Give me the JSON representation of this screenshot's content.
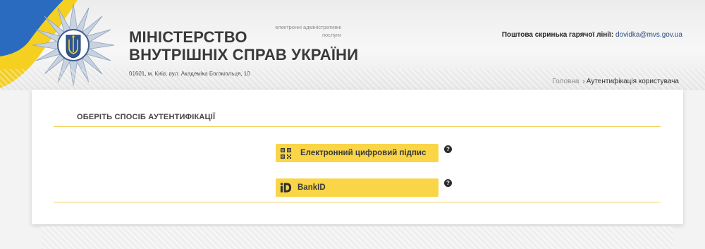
{
  "header": {
    "title_line1": "МІНІСТЕРСТВО",
    "title_line2": "ВНУТРІШНІХ СПРАВ УКРАЇНИ",
    "services_label": "електронні адміністративні послуги",
    "address": "01601, м. Київ, вул. Академіка Богомольця, 10",
    "hotline_label": "Поштова скринька гарячої лінії:",
    "hotline_email": "dovidka@mvs.gov.ua",
    "flag_colors": [
      "#2a6bbf",
      "#f5d020"
    ]
  },
  "breadcrumb": {
    "home": "Головна",
    "separator": "›",
    "current": "Аутентифікація користувача"
  },
  "auth": {
    "title": "ОБЕРІТЬ СПОСІБ АУТЕНТИФІКАЦІЇ",
    "options": [
      {
        "label": "Електронний цифровий підпис",
        "icon": "qr-code-icon",
        "help": "?"
      },
      {
        "label": "BankID",
        "icon": "bankid-icon",
        "help": "?"
      }
    ],
    "accent": "#f9d547"
  }
}
